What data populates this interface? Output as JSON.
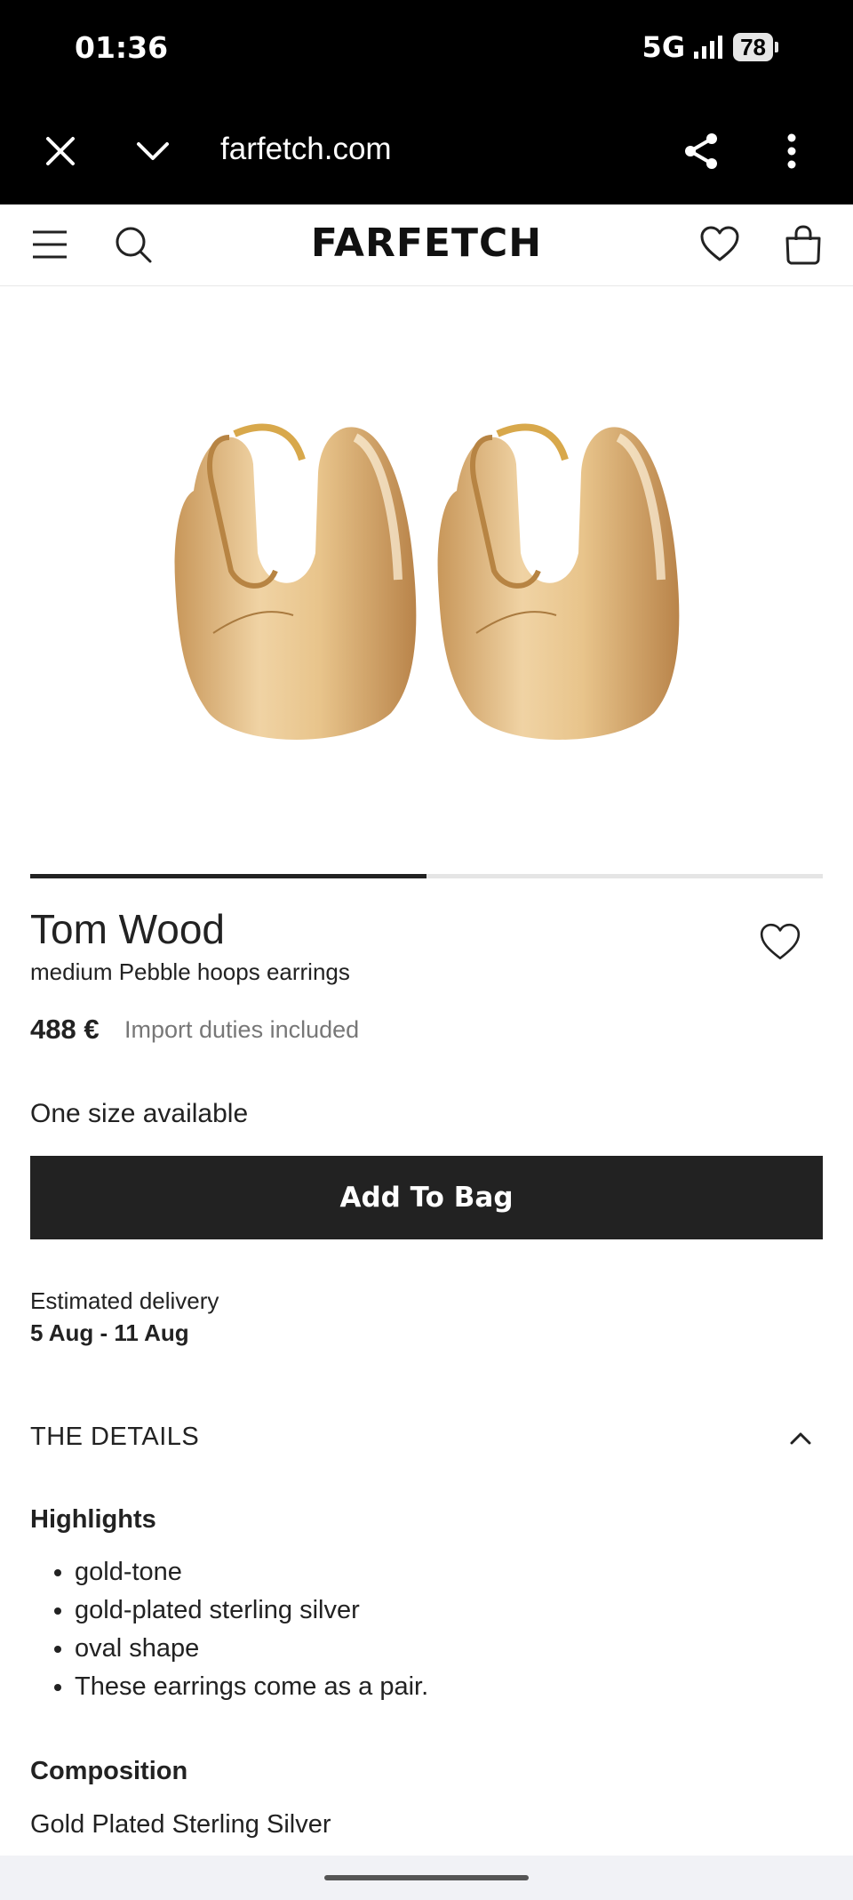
{
  "status_bar": {
    "time": "01:36",
    "network": "5G",
    "battery": "78"
  },
  "browser": {
    "url": "farfetch.com"
  },
  "site": {
    "logo": "FARFETCH"
  },
  "gallery": {
    "progress_fraction": 0.5
  },
  "product": {
    "brand": "Tom Wood",
    "name": "medium Pebble hoops earrings",
    "price": "488 €",
    "duties_note": "Import duties included",
    "size_info": "One size available",
    "add_to_bag": "Add To Bag"
  },
  "delivery": {
    "label": "Estimated delivery",
    "dates": "5 Aug - 11 Aug"
  },
  "details": {
    "header": "THE DETAILS",
    "highlights_title": "Highlights",
    "highlights": [
      "gold-tone",
      "gold-plated sterling silver",
      "oval shape",
      "These earrings come as a pair."
    ],
    "composition_title": "Composition",
    "composition": "Gold Plated Sterling Silver"
  },
  "colors": {
    "dark": "#222222",
    "muted": "#777777",
    "gold": "#d6ad6a"
  }
}
